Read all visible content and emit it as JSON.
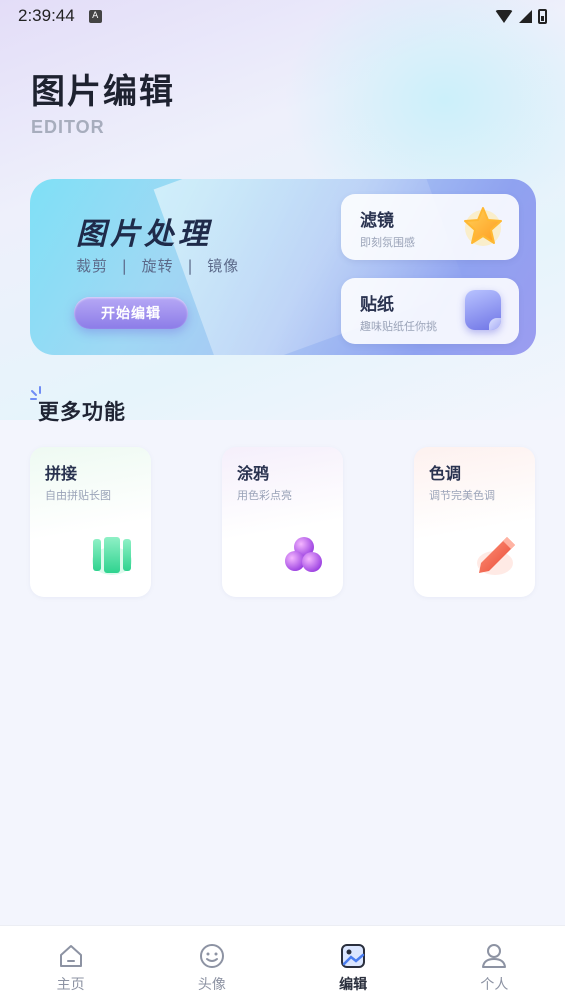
{
  "status_bar": {
    "time": "2:39:44",
    "notification_icon": "A"
  },
  "header": {
    "title": "图片编辑",
    "subtitle": "EDITOR"
  },
  "banner": {
    "title": "图片处理",
    "tags": [
      "裁剪",
      "旋转",
      "镜像"
    ],
    "separator": "|",
    "start_button": "开始编辑",
    "cards": [
      {
        "title": "滤镜",
        "subtitle": "即刻氛围感",
        "icon": "star-icon"
      },
      {
        "title": "贴纸",
        "subtitle": "趣味贴纸任你挑",
        "icon": "sticker-icon"
      }
    ]
  },
  "section": {
    "title": "更多功能"
  },
  "features": [
    {
      "title": "拼接",
      "subtitle": "自由拼贴长图",
      "icon": "collage-icon"
    },
    {
      "title": "涂鸦",
      "subtitle": "用色彩点亮",
      "icon": "paint-balls-icon"
    },
    {
      "title": "色调",
      "subtitle": "调节完美色调",
      "icon": "pencil-icon"
    }
  ],
  "tabbar": {
    "tabs": [
      {
        "label": "主页",
        "icon": "home-icon"
      },
      {
        "label": "头像",
        "icon": "smile-face-icon"
      },
      {
        "label": "编辑",
        "icon": "image-edit-icon",
        "active": true
      },
      {
        "label": "个人",
        "icon": "person-icon"
      }
    ]
  },
  "colors": {
    "accent": "#8c7ce8",
    "banner_start": "#7fe0f6",
    "banner_end": "#9b9cf0"
  }
}
